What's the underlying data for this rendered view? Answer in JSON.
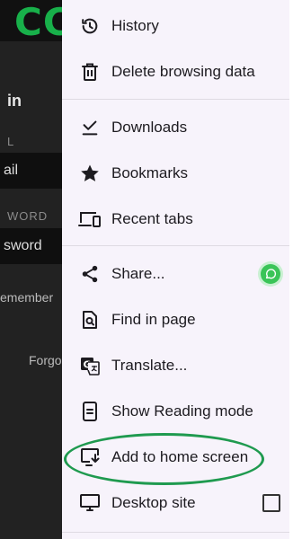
{
  "background_page": {
    "logo_text": "CC",
    "login_heading": "in",
    "email_label": "L",
    "email_value": "ail",
    "password_label": "WORD",
    "password_value": "sword",
    "remember_text": "emember",
    "forgot_text": "Forgo"
  },
  "menu": {
    "items": [
      {
        "label": "History",
        "icon": "history-icon"
      },
      {
        "label": "Delete browsing data",
        "icon": "trash-icon"
      },
      {
        "label": "Downloads",
        "icon": "download-check-icon"
      },
      {
        "label": "Bookmarks",
        "icon": "star-icon"
      },
      {
        "label": "Recent tabs",
        "icon": "devices-icon"
      },
      {
        "label": "Share...",
        "icon": "share-icon"
      },
      {
        "label": "Find in page",
        "icon": "find-in-page-icon"
      },
      {
        "label": "Translate...",
        "icon": "translate-icon"
      },
      {
        "label": "Show Reading mode",
        "icon": "reading-mode-icon"
      },
      {
        "label": "Add to home screen",
        "icon": "add-to-home-icon"
      },
      {
        "label": "Desktop site",
        "icon": "desktop-icon"
      }
    ],
    "share_badge_icon": "whatsapp-icon",
    "desktop_site_checked": false,
    "highlighted_item": "Add to home screen",
    "highlight_color": "#1f9a4f"
  }
}
